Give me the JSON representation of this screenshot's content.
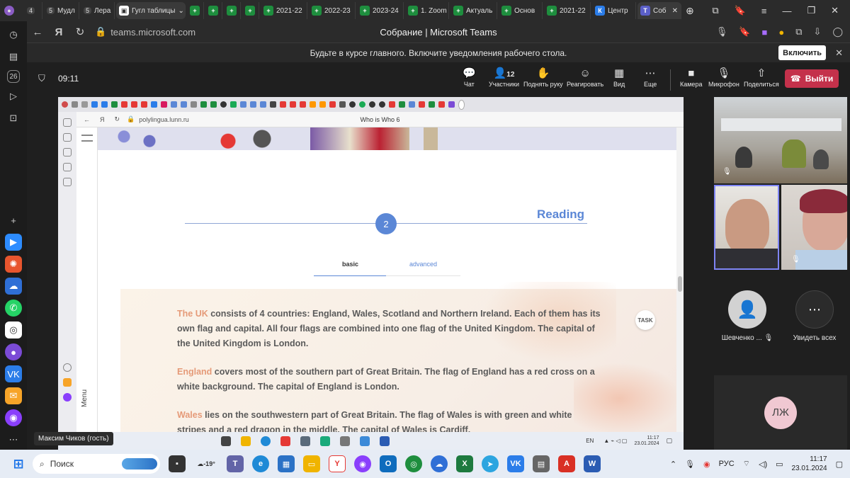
{
  "browser_tabs": [
    {
      "label": "4",
      "kind": "count",
      "color": "#8a5cc4"
    },
    {
      "label": "Мудл",
      "count": "5",
      "color": "#444"
    },
    {
      "label": "Лера",
      "count": "5",
      "color": "#444"
    },
    {
      "label": "Гугл таблицы",
      "color": "#1e8e3e"
    },
    {
      "label": "",
      "color": "#1e8e3e"
    },
    {
      "label": "",
      "color": "#1e8e3e"
    },
    {
      "label": "",
      "color": "#1e8e3e"
    },
    {
      "label": "2021-22",
      "color": "#1e8e3e"
    },
    {
      "label": "2022-23",
      "color": "#1e8e3e"
    },
    {
      "label": "2023-24",
      "color": "#1e8e3e"
    },
    {
      "label": "1. Zoom",
      "color": "#1e8e3e"
    },
    {
      "label": "Актуаль",
      "color": "#1e8e3e"
    },
    {
      "label": "Основ",
      "color": "#1e8e3e"
    },
    {
      "label": "2021-22",
      "color": "#1e8e3e"
    },
    {
      "label": "Центр",
      "color": "#2b7de9"
    },
    {
      "label": "Соб",
      "color": "#5b5fc7",
      "active": true
    }
  ],
  "address": {
    "url": "teams.microsoft.com",
    "page_title": "Собрание | Microsoft Teams"
  },
  "notification": {
    "text": "Будьте в курсе главного. Включите уведомления рабочего стола.",
    "button": "Включить"
  },
  "teams_toolbar": {
    "time": "09:11",
    "items": [
      {
        "icon": "💬",
        "label": "Чат"
      },
      {
        "icon": "👤",
        "label": "Участники",
        "badge": "12"
      },
      {
        "icon": "✋",
        "label": "Поднять руку"
      },
      {
        "icon": "☺",
        "label": "Реагировать"
      },
      {
        "icon": "▦",
        "label": "Вид"
      },
      {
        "icon": "⋯",
        "label": "Еще"
      },
      {
        "icon": "■",
        "label": "Камера"
      },
      {
        "icon": "🎙",
        "label": "Микрофон"
      },
      {
        "icon": "⇧",
        "label": "Поделиться"
      }
    ],
    "leave": "Выйти"
  },
  "participants": [
    {
      "label": "Шевченко ...",
      "icon": "👤"
    },
    {
      "label": "Увидеть всех",
      "icon": "⋯"
    },
    {
      "initials": "ЛЖ"
    }
  ],
  "shared": {
    "inner_url": "polylingua.lunn.ru",
    "inner_title": "Who is Who 6",
    "menu": "Menu",
    "section_title": "Reading",
    "section_number": "2",
    "level_basic": "basic",
    "level_advanced": "advanced",
    "task": "TASK",
    "paragraphs": [
      {
        "hl": "The UK",
        "text": " consists of 4 countries: England, Wales, Scotland and Northern Ireland. Each of them has its own flag and capital. All four flags are combined into one flag of the United Kingdom. The capital of the United Kingdom is London."
      },
      {
        "hl": "England",
        "text": " covers most of the southern part of Great Britain. The flag of England has a red cross on a white background. The capital of England is London."
      },
      {
        "hl": "Wales",
        "text": " lies on the southwestern part of Great Britain. The flag of Wales is with green and white stripes and a red dragon in the middle. The capital of Wales is Cardiff."
      }
    ],
    "inner_clock_time": "11:17",
    "inner_clock_date": "23.01.2024",
    "inner_lang": "EN"
  },
  "speaker_name": "Максим Чиков (гость)",
  "taskbar": {
    "search": "Поиск",
    "weather": "-19°",
    "lang": "РУС",
    "time": "11:17",
    "date": "23.01.2024"
  }
}
